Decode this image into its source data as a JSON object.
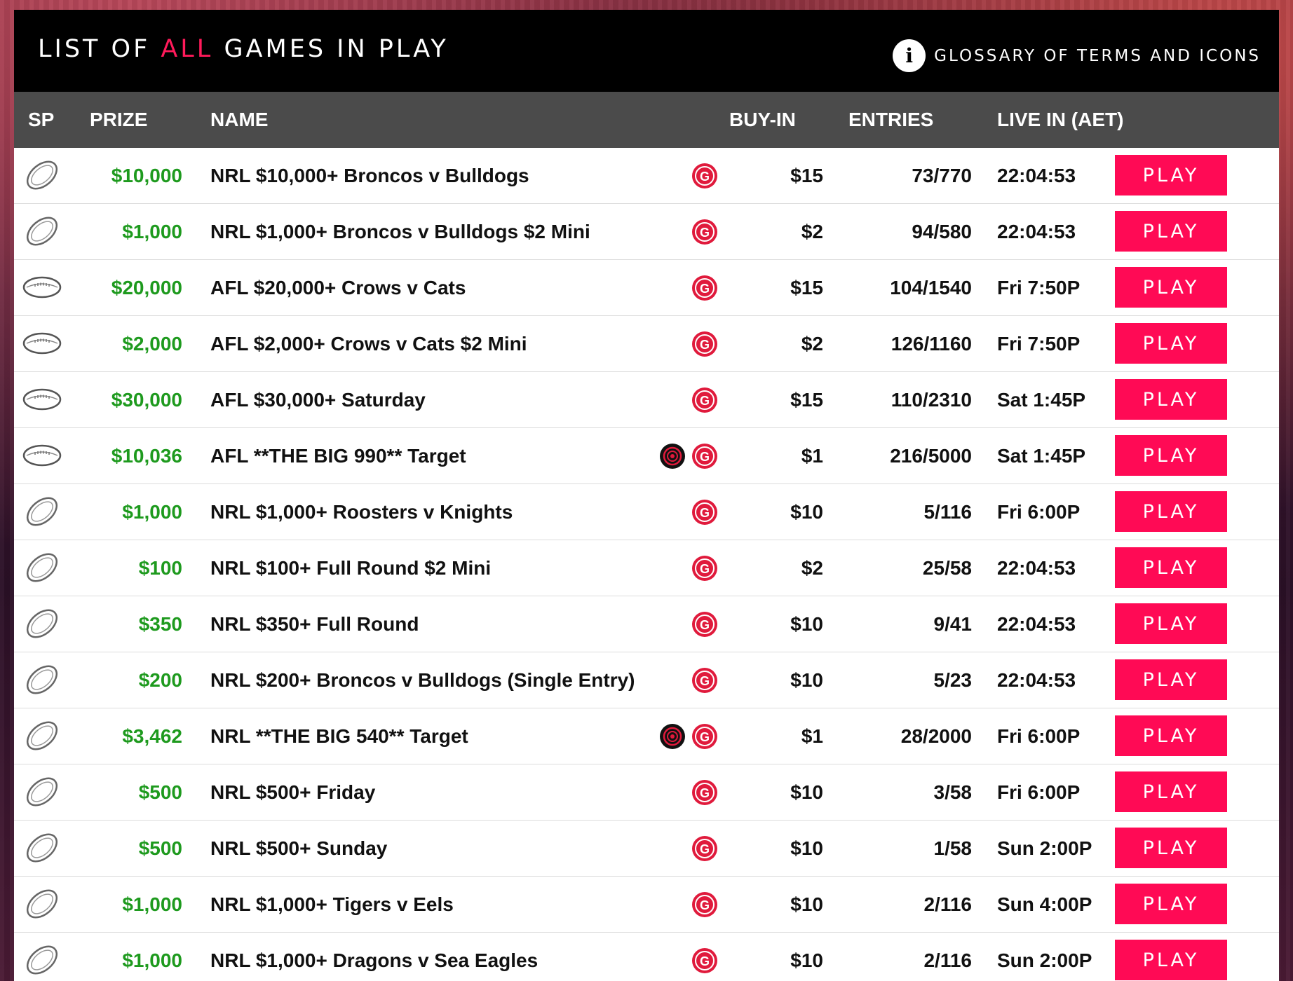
{
  "header": {
    "title_before": "LIST OF ",
    "title_accent": "ALL",
    "title_after": " GAMES IN PLAY",
    "glossary_label": "GLOSSARY OF TERMS AND ICONS",
    "glossary_icon": "info-icon",
    "info_glyph": "i"
  },
  "columns": {
    "sp": "SP",
    "prize": "PRIZE",
    "name": "NAME",
    "buyin": "BUY-IN",
    "entries": "ENTRIES",
    "live": "LIVE IN (AET)"
  },
  "colors": {
    "accent": "#ff0a55",
    "prize": "#1e9a1e",
    "header_bg": "#000000",
    "column_header_bg": "#4b4b4b"
  },
  "play_label": "PLAY",
  "g_glyph": "G",
  "rows": [
    {
      "sport": "nrl",
      "prize": "$10,000",
      "name": "NRL $10,000+ Broncos v Bulldogs",
      "target": false,
      "buyin": "$15",
      "entries": "73/770",
      "live": "22:04:53"
    },
    {
      "sport": "nrl",
      "prize": "$1,000",
      "name": "NRL $1,000+ Broncos v Bulldogs $2 Mini",
      "target": false,
      "buyin": "$2",
      "entries": "94/580",
      "live": "22:04:53"
    },
    {
      "sport": "afl",
      "prize": "$20,000",
      "name": "AFL $20,000+ Crows v Cats",
      "target": false,
      "buyin": "$15",
      "entries": "104/1540",
      "live": "Fri 7:50P"
    },
    {
      "sport": "afl",
      "prize": "$2,000",
      "name": "AFL $2,000+ Crows v Cats $2 Mini",
      "target": false,
      "buyin": "$2",
      "entries": "126/1160",
      "live": "Fri 7:50P"
    },
    {
      "sport": "afl",
      "prize": "$30,000",
      "name": "AFL $30,000+ Saturday",
      "target": false,
      "buyin": "$15",
      "entries": "110/2310",
      "live": "Sat 1:45P"
    },
    {
      "sport": "afl",
      "prize": "$10,036",
      "name": "AFL **THE BIG 990** Target",
      "target": true,
      "buyin": "$1",
      "entries": "216/5000",
      "live": "Sat 1:45P"
    },
    {
      "sport": "nrl",
      "prize": "$1,000",
      "name": "NRL $1,000+ Roosters v Knights",
      "target": false,
      "buyin": "$10",
      "entries": "5/116",
      "live": "Fri 6:00P"
    },
    {
      "sport": "nrl",
      "prize": "$100",
      "name": "NRL $100+ Full Round $2 Mini",
      "target": false,
      "buyin": "$2",
      "entries": "25/58",
      "live": "22:04:53"
    },
    {
      "sport": "nrl",
      "prize": "$350",
      "name": "NRL $350+ Full Round",
      "target": false,
      "buyin": "$10",
      "entries": "9/41",
      "live": "22:04:53"
    },
    {
      "sport": "nrl",
      "prize": "$200",
      "name": "NRL $200+ Broncos v Bulldogs (Single Entry)",
      "target": false,
      "buyin": "$10",
      "entries": "5/23",
      "live": "22:04:53"
    },
    {
      "sport": "nrl",
      "prize": "$3,462",
      "name": "NRL **THE BIG 540** Target",
      "target": true,
      "buyin": "$1",
      "entries": "28/2000",
      "live": "Fri 6:00P"
    },
    {
      "sport": "nrl",
      "prize": "$500",
      "name": "NRL $500+ Friday",
      "target": false,
      "buyin": "$10",
      "entries": "3/58",
      "live": "Fri 6:00P"
    },
    {
      "sport": "nrl",
      "prize": "$500",
      "name": "NRL $500+ Sunday",
      "target": false,
      "buyin": "$10",
      "entries": "1/58",
      "live": "Sun 2:00P"
    },
    {
      "sport": "nrl",
      "prize": "$1,000",
      "name": "NRL $1,000+ Tigers v Eels",
      "target": false,
      "buyin": "$10",
      "entries": "2/116",
      "live": "Sun 4:00P"
    },
    {
      "sport": "nrl",
      "prize": "$1,000",
      "name": "NRL $1,000+ Dragons v Sea Eagles",
      "target": false,
      "buyin": "$10",
      "entries": "2/116",
      "live": "Sun 2:00P"
    }
  ]
}
